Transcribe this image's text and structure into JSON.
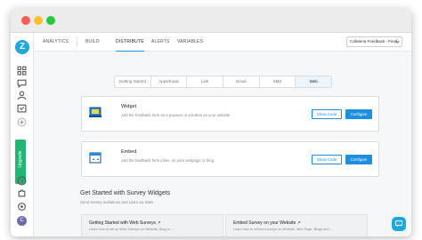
{
  "sidebar": {
    "logo_letter": "Z",
    "upgrade_label": "Upgrade",
    "avatar_letter": "C",
    "icons": [
      "grid-icon",
      "chat-icon",
      "person-icon",
      "calendar-icon",
      "plus-icon",
      "help-icon",
      "puzzle-icon",
      "settings-icon"
    ]
  },
  "topnav": {
    "items": [
      "ANALYTICS",
      "BUILD",
      "DISTRIBUTE",
      "ALERTS",
      "VARIABLES"
    ],
    "active": "DISTRIBUTE",
    "survey_selected": "Cafeteria Feedback - Final"
  },
  "tabs": {
    "items": [
      "Getting Started",
      "Apps/Kiosk",
      "Link",
      "Email",
      "SMS",
      "Web"
    ],
    "active": "Web"
  },
  "cards": [
    {
      "title": "Widget",
      "desc": "Add the feedback form as a popover or a button on your website",
      "show_code": "Show Code",
      "configure": "Configure"
    },
    {
      "title": "Embed",
      "desc": "Add the feedback form inline, on your webpage or blog.",
      "show_code": "Show Code",
      "configure": "Configure"
    }
  ],
  "section": {
    "title": "Get Started with Survey Widgets",
    "subtitle": "Send Survey Invitations and Links via SMS"
  },
  "guides": [
    {
      "title": "Getting Started with Web Surveys",
      "desc": "Learn how to set up Web Surveys on Website, Blog or ..."
    },
    {
      "title": "Embed Survey on your Website",
      "desc": "Learn how to embed surveys on Website, Web Page, Blogs and ..."
    }
  ],
  "colors": {
    "accent": "#1d8fe0",
    "upgrade": "#22b573",
    "brand": "#1fa7e0"
  }
}
